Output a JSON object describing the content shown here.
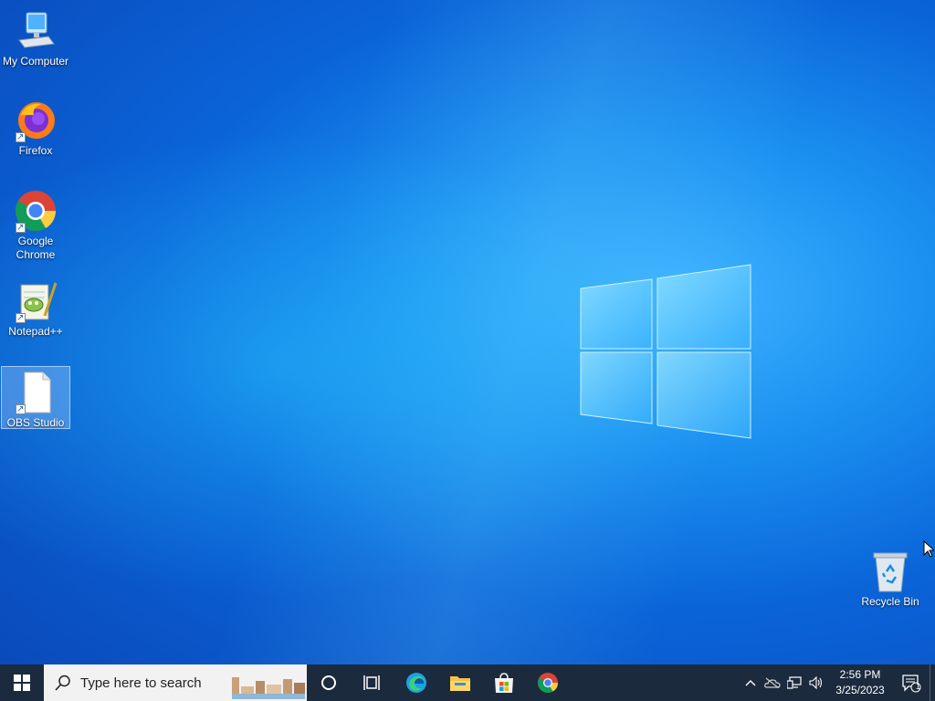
{
  "desktop": {
    "icons": [
      {
        "label": "My Computer",
        "icon": "computer-icon"
      },
      {
        "label": "Firefox",
        "icon": "firefox-icon"
      },
      {
        "label": "Google Chrome",
        "icon": "chrome-icon"
      },
      {
        "label": "Notepad++",
        "icon": "notepadpp-icon"
      },
      {
        "label": "OBS Studio",
        "icon": "file-icon",
        "selected": true
      },
      {
        "label": "Recycle Bin",
        "icon": "recycle-bin-icon"
      }
    ]
  },
  "taskbar": {
    "start_icon": "windows-start-icon",
    "search_placeholder": "Type here to search",
    "pinned": [
      "cortana-icon",
      "task-view-icon",
      "edge-icon",
      "file-explorer-icon",
      "store-icon",
      "chrome-icon"
    ],
    "tray_icons": [
      "chevron-up-icon",
      "onedrive-icon",
      "network-icon",
      "volume-icon"
    ],
    "time": "2:56 PM",
    "date": "3/25/2023",
    "notification_count": "1"
  },
  "colors": {
    "taskbar_bg": "#1c2a3d",
    "desktop_accent": "#1a8ff0"
  }
}
